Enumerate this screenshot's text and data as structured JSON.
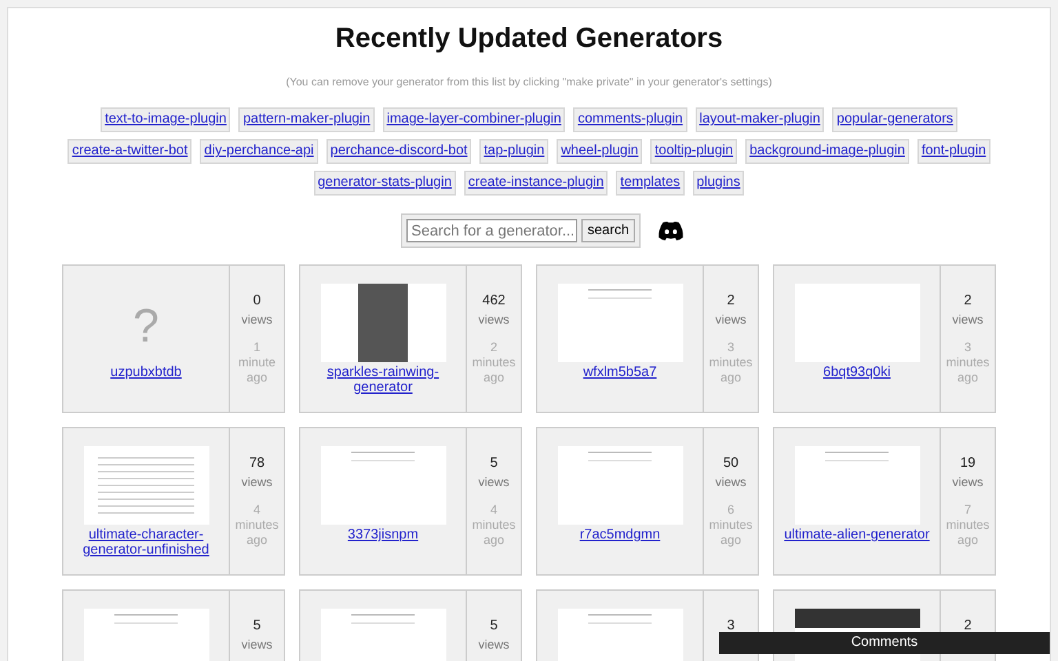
{
  "title": "Recently Updated Generators",
  "note": "(You can remove your generator from this list by clicking \"make private\" in your generator's settings)",
  "tags": [
    "text-to-image-plugin",
    "pattern-maker-plugin",
    "image-layer-combiner-plugin",
    "comments-plugin",
    "layout-maker-plugin",
    "popular-generators",
    "create-a-twitter-bot",
    "diy-perchance-api",
    "perchance-discord-bot",
    "tap-plugin",
    "wheel-plugin",
    "tooltip-plugin",
    "background-image-plugin",
    "font-plugin",
    "generator-stats-plugin",
    "create-instance-plugin",
    "templates",
    "plugins"
  ],
  "search": {
    "placeholder": "Search for a generator...",
    "button": "search"
  },
  "generators": [
    {
      "name": "uzpubxbtdb",
      "thumb": {
        "kind": "missing",
        "glyph": "?"
      },
      "views": "0",
      "views_label": "views",
      "time": [
        "1",
        "minute",
        "ago"
      ]
    },
    {
      "name": "sparkles-rainwing-generator",
      "thumb": {
        "kind": "dark"
      },
      "views": "462",
      "views_label": "views",
      "time": [
        "2",
        "minutes",
        "ago"
      ]
    },
    {
      "name": "wfxlm5b5a7",
      "thumb": {
        "kind": "light"
      },
      "views": "2",
      "views_label": "views",
      "time": [
        "3",
        "minutes",
        "ago"
      ]
    },
    {
      "name": "6bqt93q0ki",
      "thumb": {
        "kind": "blank"
      },
      "views": "2",
      "views_label": "views",
      "time": [
        "3",
        "minutes",
        "ago"
      ]
    },
    {
      "name": "ultimate-character-generator-unfinished",
      "thumb": {
        "kind": "text"
      },
      "views": "78",
      "views_label": "views",
      "time": [
        "4",
        "minutes",
        "ago"
      ]
    },
    {
      "name": "3373jisnpm",
      "thumb": {
        "kind": "light"
      },
      "views": "5",
      "views_label": "views",
      "time": [
        "4",
        "minutes",
        "ago"
      ]
    },
    {
      "name": "r7ac5mdgmn",
      "thumb": {
        "kind": "light"
      },
      "views": "50",
      "views_label": "views",
      "time": [
        "6",
        "minutes",
        "ago"
      ]
    },
    {
      "name": "ultimate-alien-generator",
      "thumb": {
        "kind": "light"
      },
      "views": "19",
      "views_label": "views",
      "time": [
        "7",
        "minutes",
        "ago"
      ]
    },
    {
      "thumb": {
        "kind": "light"
      },
      "views": "5",
      "views_label": "views"
    },
    {
      "thumb": {
        "kind": "light"
      },
      "views": "5",
      "views_label": "views"
    },
    {
      "thumb": {
        "kind": "light"
      },
      "views": "3"
    },
    {
      "thumb": {
        "kind": "dark-banner"
      },
      "views": "2"
    }
  ],
  "comments": {
    "label": "Comments"
  }
}
